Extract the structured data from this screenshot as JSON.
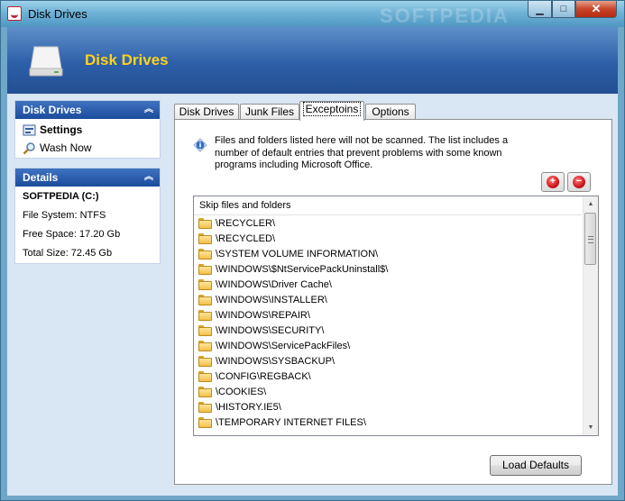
{
  "window": {
    "title": "Disk Drives",
    "watermark": "SOFTPEDIA",
    "minimize_glyph": "▁",
    "maximize_glyph": "□",
    "close_glyph": "✕"
  },
  "banner": {
    "title": "Disk Drives"
  },
  "sidebar": {
    "nav_panel": {
      "title": "Disk Drives",
      "collapse_glyph": "︽",
      "items": [
        {
          "label": "Settings",
          "icon": "settings-icon"
        },
        {
          "label": "Wash Now",
          "icon": "magnifier-icon"
        }
      ]
    },
    "details_panel": {
      "title": "Details",
      "collapse_glyph": "︽",
      "drive_name": "SOFTPEDIA (C:)",
      "file_system": "File System: NTFS",
      "free_space": "Free Space: 17.20 Gb",
      "total_size": "Total Size: 72.45 Gb"
    }
  },
  "tabs": [
    {
      "label": "Disk Drives",
      "active": false
    },
    {
      "label": "Junk Files",
      "active": false
    },
    {
      "label": "Exceptoins",
      "active": true
    },
    {
      "label": "Options",
      "active": false
    }
  ],
  "exceptions": {
    "info_text": "Files and folders listed here will not be scanned. The list includes a number of default entries that prevent problems with some known programs including Microsoft Office.",
    "add_glyph": "+",
    "remove_glyph": "−",
    "list_header": "Skip files and folders",
    "items": [
      "\\RECYCLER\\",
      "\\RECYCLED\\",
      "\\SYSTEM VOLUME INFORMATION\\",
      "\\WINDOWS\\$NtServicePackUninstall$\\",
      "\\WINDOWS\\Driver Cache\\",
      "\\WINDOWS\\INSTALLER\\",
      "\\WINDOWS\\REPAIR\\",
      "\\WINDOWS\\SECURITY\\",
      "\\WINDOWS\\ServicePackFiles\\",
      "\\WINDOWS\\SYSBACKUP\\",
      "\\CONFIG\\REGBACK\\",
      "\\COOKIES\\",
      "\\HISTORY.IE5\\",
      "\\TEMPORARY INTERNET FILES\\"
    ],
    "scroll_up_glyph": "▲",
    "scroll_down_glyph": "▼",
    "load_defaults_label": "Load Defaults"
  }
}
